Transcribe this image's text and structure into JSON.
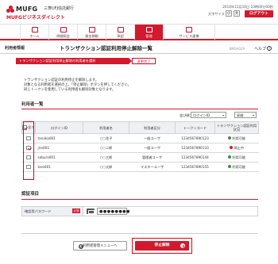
{
  "header": {
    "logo_text": "MUFG",
    "bank_name": "三菱UFJ信託銀行",
    "service_name": "MUFGビジネスダイレクト",
    "datetime": "2014年11月16日 10時00分00秒",
    "font_size_label": "文字サイズ",
    "font_small": "小",
    "font_large": "大",
    "logout_label": "ログアウト"
  },
  "nav": {
    "items": [
      {
        "label": "ホーム"
      },
      {
        "label": "明細照会"
      },
      {
        "label": "資金移動"
      },
      {
        "label": "承認"
      },
      {
        "label": "管理"
      },
      {
        "label": "サービス連携"
      }
    ]
  },
  "title": {
    "category": "利用者情報",
    "main": "トランザクション認証利用停止解除一覧",
    "screen_id": "BMSA029",
    "help": "ヘルプ"
  },
  "steps": {
    "current": "トランザクション認証利用停止解除の利用者を選択",
    "next": "変更完了"
  },
  "instructions": {
    "line1": "トランザクション認証の利用停止を解除します。",
    "line2": "対象となる利用者を選択の上、「停止解除」ボタンを押してください。",
    "line3": "同じトークンを使用している利用者も解除対象となります。"
  },
  "users_section": {
    "heading": "利用者一覧",
    "sort_label": "並び順：",
    "sort_value": "ログインID",
    "order_value": "昇順"
  },
  "table": {
    "headers": [
      "全て",
      "ログインID",
      "利用者名",
      "利用者区分",
      "トークンコード",
      "トランザクション認証利用状況"
    ],
    "rows": [
      {
        "login_id": "tanaka001",
        "name": "○○花子",
        "category": "一般ユーザ",
        "token": "1234567890123",
        "status": "利用可能"
      },
      {
        "login_id": "jiro001",
        "name": "○○二郎",
        "category": "一般ユーザ",
        "token": "1234567890133",
        "status": "停止中"
      },
      {
        "login_id": "saburo001",
        "name": "○○三郎",
        "category": "管理者ユーザ",
        "token": "1234567890144",
        "status": "利用可能"
      },
      {
        "login_id": "taro001",
        "name": "○○太郎",
        "category": "マスターユーザ",
        "token": "1234567890155",
        "status": "利用可能"
      }
    ],
    "row_checked": [
      false,
      true,
      false,
      false
    ],
    "row_status_type": [
      "ok",
      "stop",
      "ok",
      "ok"
    ]
  },
  "auth": {
    "heading": "認証項目",
    "label": "確認用パスワード",
    "required": "必須",
    "password_value": "●●●●●●●●"
  },
  "footer": {
    "back_label": "利用者管理メニューへ",
    "submit_label": "停止解除"
  },
  "colors": {
    "brand_red": "#d3192d",
    "highlight_red": "#e60012",
    "status_ok": "#3a8d4a"
  }
}
